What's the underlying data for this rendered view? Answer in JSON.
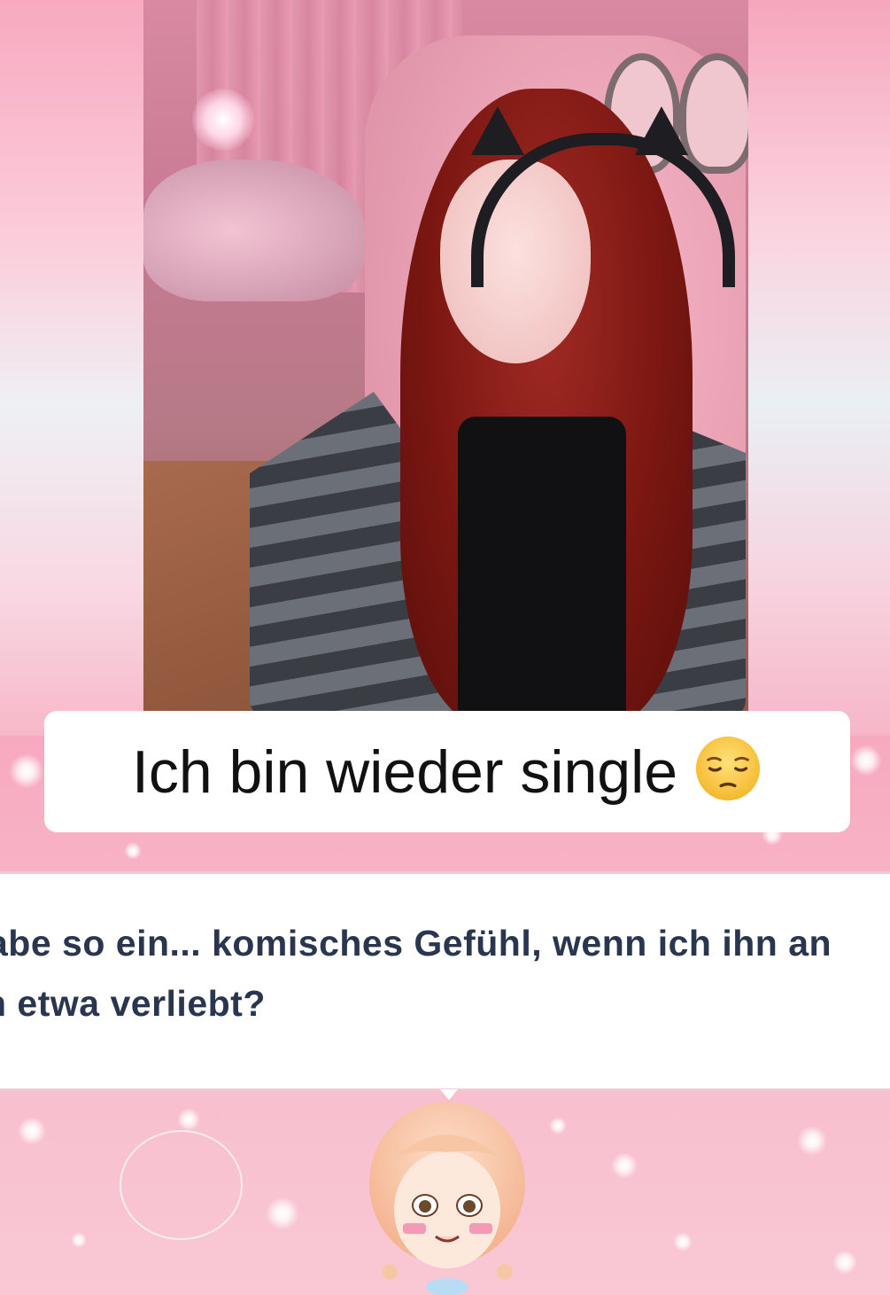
{
  "caption": {
    "text": "Ich bin wieder single",
    "emoji": "pensive-face"
  },
  "dialog": {
    "line1": "abe so ein... komisches Gefühl, wenn ich ihn an",
    "line2": "h etwa verliebt?"
  },
  "colors": {
    "background_pink": "#f7b6c9",
    "caption_bg": "#ffffff",
    "caption_text": "#111111",
    "dialog_text": "#2a3550",
    "dialog_border": "#f3c8d4"
  }
}
